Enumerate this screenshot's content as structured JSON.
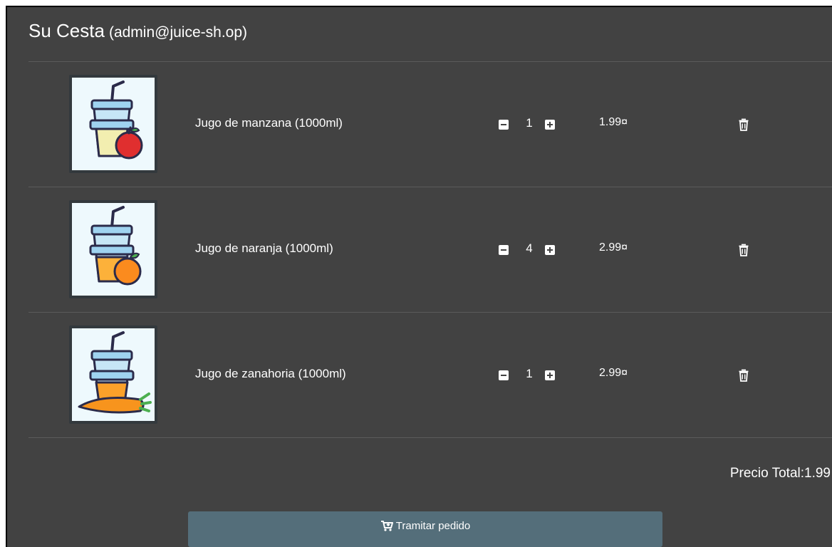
{
  "basket": {
    "title": "Su Cesta",
    "user": "(admin@juice-sh.op)"
  },
  "items": [
    {
      "name": "Jugo de manzana (1000ml)",
      "quantity": "1",
      "price": "1.99¤",
      "image_icon": "apple-juice-image",
      "fill_color": "#f2eeb0",
      "fruit_color": "#e02f2f"
    },
    {
      "name": "Jugo de naranja (1000ml)",
      "quantity": "4",
      "price": "2.99¤",
      "image_icon": "orange-juice-image",
      "fill_color": "#fcb13a",
      "fruit_color": "#fb8b1e"
    },
    {
      "name": "Jugo de zanahoria (1000ml)",
      "quantity": "1",
      "price": "2.99¤",
      "image_icon": "carrot-juice-image",
      "fill_color": "#fba12a",
      "fruit_color": "#f7941d"
    }
  ],
  "summary": {
    "total_label": "Precio Total:1.99"
  },
  "checkout": {
    "label": "Tramitar pedido",
    "icon": "cart-arrow-icon"
  },
  "colors": {
    "background": "#424242",
    "button": "#546e7a",
    "text": "#ffffff"
  }
}
